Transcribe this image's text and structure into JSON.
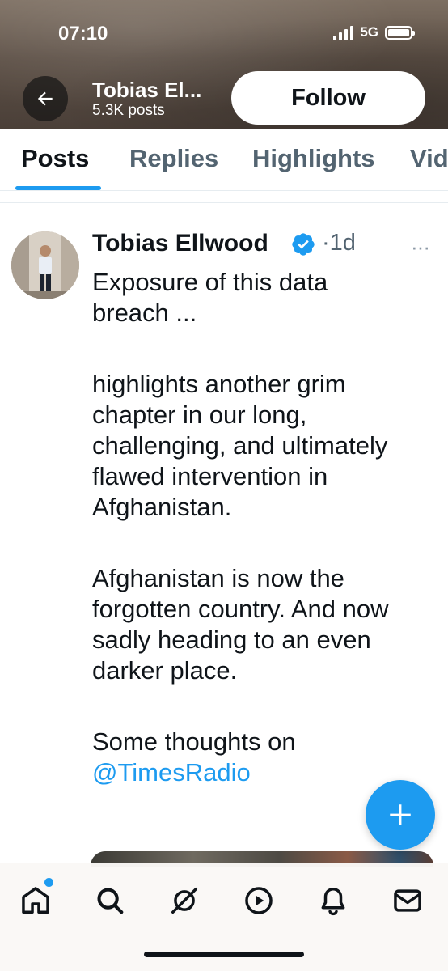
{
  "status_bar": {
    "time": "07:10",
    "network": "5G"
  },
  "header": {
    "name": "Tobias El...",
    "posts_count": "5.3K posts",
    "follow_label": "Follow"
  },
  "tabs": [
    {
      "label": "Posts",
      "active": true
    },
    {
      "label": "Replies",
      "active": false
    },
    {
      "label": "Highlights",
      "active": false
    },
    {
      "label": "Vid",
      "active": false
    }
  ],
  "post": {
    "author": "Tobias Ellwood",
    "separator": "·",
    "time": "1d",
    "more": "···",
    "paragraphs": [
      [
        "Exposure of this data",
        "breach ..."
      ],
      [
        "highlights another grim",
        "chapter in our long,",
        "challenging, and ultimately",
        "flawed intervention in",
        "Afghanistan."
      ],
      [
        "Afghanistan is now the",
        "forgotten country. And now",
        "sadly heading to an even",
        "darker place."
      ]
    ],
    "last_paragraph_line": "Some thoughts on",
    "mention": "@TimesRadio"
  },
  "bottom_nav": [
    {
      "icon": "home-icon"
    },
    {
      "icon": "search-icon"
    },
    {
      "icon": "grok-icon"
    },
    {
      "icon": "video-icon"
    },
    {
      "icon": "notifications-bell-icon"
    },
    {
      "icon": "messages-envelope-icon"
    }
  ],
  "colors": {
    "accent": "#1d9bf0",
    "text": "#0f1419",
    "muted": "#536471"
  }
}
